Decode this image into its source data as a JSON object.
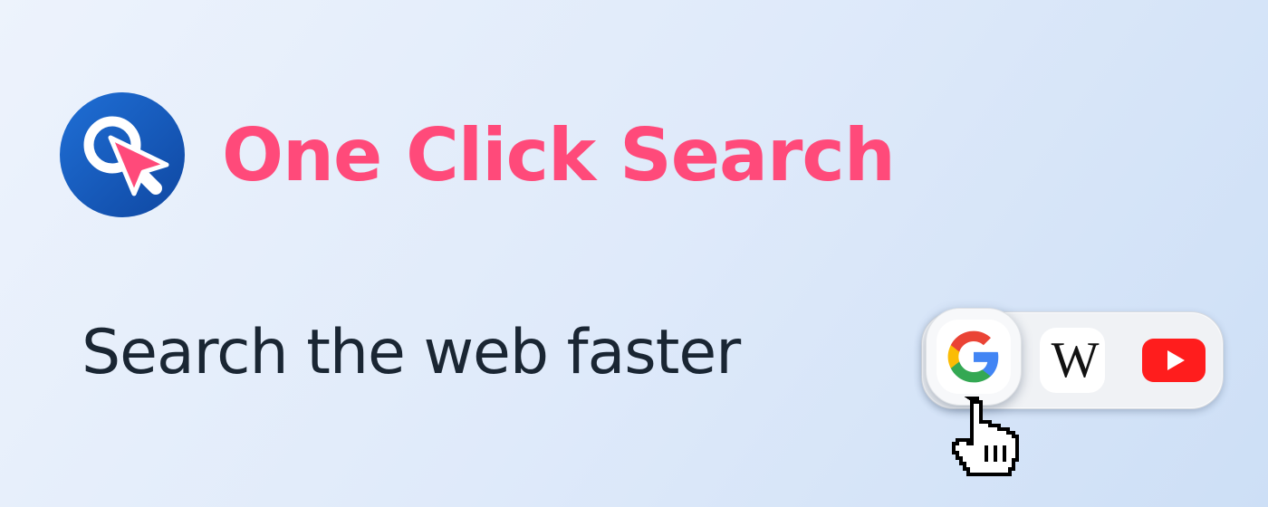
{
  "brand": {
    "title": "One Click Search",
    "tagline": "Search the web faster",
    "logo_icon": "magnifier-cursor-logo-icon",
    "colors": {
      "title": "#ff4a7a",
      "logo_background": "#1657b8",
      "logo_pointer": "#ff4a7a",
      "tagline": "#1a2633"
    }
  },
  "toolbar": {
    "engines": [
      {
        "name": "Google",
        "icon": "google-icon",
        "state": "hovered"
      },
      {
        "name": "Wikipedia",
        "icon": "wikipedia-icon",
        "glyph": "W"
      },
      {
        "name": "YouTube",
        "icon": "youtube-icon"
      }
    ],
    "cursor_icon": "hand-pointer-icon"
  }
}
